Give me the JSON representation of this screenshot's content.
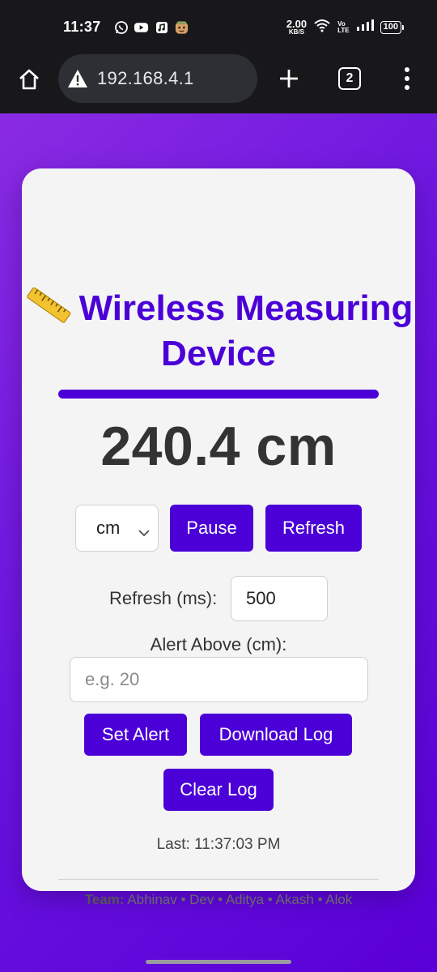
{
  "status_bar": {
    "time": "11:37",
    "net_speed_value": "2.00",
    "net_speed_unit": "KB/S",
    "volte_top": "Vo",
    "volte_bottom": "LTE",
    "battery": "100"
  },
  "browser": {
    "url": "192.168.4.1",
    "tab_count": "2"
  },
  "app": {
    "title": "Wireless Measuring Device",
    "reading": "240.4 cm",
    "unit_select": {
      "selected": "cm"
    },
    "buttons": {
      "pause": "Pause",
      "refresh": "Refresh",
      "set_alert": "Set Alert",
      "download_log": "Download Log",
      "clear_log": "Clear Log"
    },
    "refresh_rate": {
      "label": "Refresh (ms):",
      "value": "500"
    },
    "alert": {
      "label": "Alert Above (cm):",
      "placeholder": "e.g. 20"
    },
    "last_update": "Last: 11:37:03 PM",
    "footer": {
      "team_label": "Team:",
      "members": "Abhinav • Dev • Aditya • Akash • Alok"
    }
  },
  "colors": {
    "accent": "#4a00d6",
    "background_gradient_start": "#8a2be2",
    "background_gradient_end": "#5a00d8",
    "card": "#f4f4f5"
  }
}
